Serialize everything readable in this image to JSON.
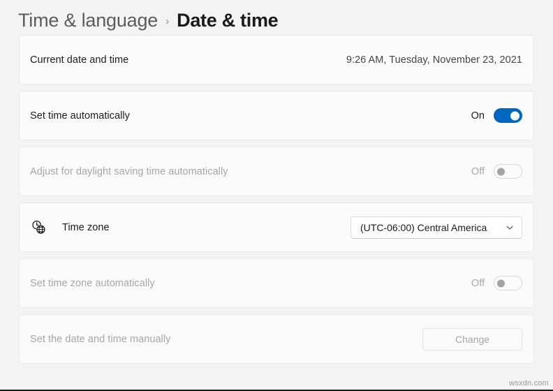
{
  "breadcrumb": {
    "parent": "Time & language",
    "separator": "›",
    "current": "Date & time"
  },
  "colors": {
    "accent": "#0067C0",
    "page_background": "#F3F3F3",
    "card_background": "#FBFBFB",
    "text_primary": "#1B1B1B",
    "text_disabled": "#A6A6A6"
  },
  "settings": [
    {
      "id": "current-date-and-time",
      "label": "Current date and time",
      "control": "text",
      "value": "9:26 AM, Tuesday, November 23, 2021",
      "disabled": false,
      "icon": null
    },
    {
      "id": "set-time-automatically",
      "label": "Set time automatically",
      "control": "toggle",
      "value": "On",
      "state": "on",
      "disabled": false,
      "icon": null
    },
    {
      "id": "adjust-daylight-saving",
      "label": "Adjust for daylight saving time automatically",
      "control": "toggle",
      "value": "Off",
      "state": "off",
      "disabled": true,
      "icon": null
    },
    {
      "id": "time-zone",
      "label": "Time zone",
      "control": "dropdown",
      "value": "(UTC-06:00) Central America",
      "disabled": false,
      "icon": "world-clock-icon"
    },
    {
      "id": "set-time-zone-automatically",
      "label": "Set time zone automatically",
      "control": "toggle",
      "value": "Off",
      "state": "off",
      "disabled": true,
      "icon": null
    },
    {
      "id": "set-date-time-manually",
      "label": "Set the date and time manually",
      "control": "button",
      "value": "Change",
      "disabled": true,
      "icon": null
    }
  ],
  "watermark": "wsxdn.com"
}
